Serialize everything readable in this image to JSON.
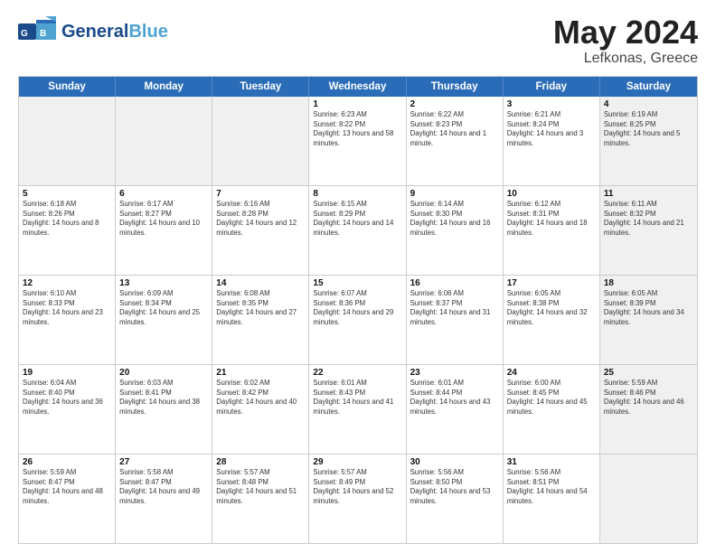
{
  "header": {
    "logo_line1": "General",
    "logo_line2": "Blue",
    "title": "May 2024",
    "location": "Lefkonas, Greece"
  },
  "weekdays": [
    "Sunday",
    "Monday",
    "Tuesday",
    "Wednesday",
    "Thursday",
    "Friday",
    "Saturday"
  ],
  "rows": [
    [
      {
        "day": "",
        "sunrise": "",
        "sunset": "",
        "daylight": "",
        "shaded": true
      },
      {
        "day": "",
        "sunrise": "",
        "sunset": "",
        "daylight": "",
        "shaded": true
      },
      {
        "day": "",
        "sunrise": "",
        "sunset": "",
        "daylight": "",
        "shaded": true
      },
      {
        "day": "1",
        "sunrise": "Sunrise: 6:23 AM",
        "sunset": "Sunset: 8:22 PM",
        "daylight": "Daylight: 13 hours and 58 minutes.",
        "shaded": false
      },
      {
        "day": "2",
        "sunrise": "Sunrise: 6:22 AM",
        "sunset": "Sunset: 8:23 PM",
        "daylight": "Daylight: 14 hours and 1 minute.",
        "shaded": false
      },
      {
        "day": "3",
        "sunrise": "Sunrise: 6:21 AM",
        "sunset": "Sunset: 8:24 PM",
        "daylight": "Daylight: 14 hours and 3 minutes.",
        "shaded": false
      },
      {
        "day": "4",
        "sunrise": "Sunrise: 6:19 AM",
        "sunset": "Sunset: 8:25 PM",
        "daylight": "Daylight: 14 hours and 5 minutes.",
        "shaded": true
      }
    ],
    [
      {
        "day": "5",
        "sunrise": "Sunrise: 6:18 AM",
        "sunset": "Sunset: 8:26 PM",
        "daylight": "Daylight: 14 hours and 8 minutes.",
        "shaded": false
      },
      {
        "day": "6",
        "sunrise": "Sunrise: 6:17 AM",
        "sunset": "Sunset: 8:27 PM",
        "daylight": "Daylight: 14 hours and 10 minutes.",
        "shaded": false
      },
      {
        "day": "7",
        "sunrise": "Sunrise: 6:16 AM",
        "sunset": "Sunset: 8:28 PM",
        "daylight": "Daylight: 14 hours and 12 minutes.",
        "shaded": false
      },
      {
        "day": "8",
        "sunrise": "Sunrise: 6:15 AM",
        "sunset": "Sunset: 8:29 PM",
        "daylight": "Daylight: 14 hours and 14 minutes.",
        "shaded": false
      },
      {
        "day": "9",
        "sunrise": "Sunrise: 6:14 AM",
        "sunset": "Sunset: 8:30 PM",
        "daylight": "Daylight: 14 hours and 16 minutes.",
        "shaded": false
      },
      {
        "day": "10",
        "sunrise": "Sunrise: 6:12 AM",
        "sunset": "Sunset: 8:31 PM",
        "daylight": "Daylight: 14 hours and 18 minutes.",
        "shaded": false
      },
      {
        "day": "11",
        "sunrise": "Sunrise: 6:11 AM",
        "sunset": "Sunset: 8:32 PM",
        "daylight": "Daylight: 14 hours and 21 minutes.",
        "shaded": true
      }
    ],
    [
      {
        "day": "12",
        "sunrise": "Sunrise: 6:10 AM",
        "sunset": "Sunset: 8:33 PM",
        "daylight": "Daylight: 14 hours and 23 minutes.",
        "shaded": false
      },
      {
        "day": "13",
        "sunrise": "Sunrise: 6:09 AM",
        "sunset": "Sunset: 8:34 PM",
        "daylight": "Daylight: 14 hours and 25 minutes.",
        "shaded": false
      },
      {
        "day": "14",
        "sunrise": "Sunrise: 6:08 AM",
        "sunset": "Sunset: 8:35 PM",
        "daylight": "Daylight: 14 hours and 27 minutes.",
        "shaded": false
      },
      {
        "day": "15",
        "sunrise": "Sunrise: 6:07 AM",
        "sunset": "Sunset: 8:36 PM",
        "daylight": "Daylight: 14 hours and 29 minutes.",
        "shaded": false
      },
      {
        "day": "16",
        "sunrise": "Sunrise: 6:06 AM",
        "sunset": "Sunset: 8:37 PM",
        "daylight": "Daylight: 14 hours and 31 minutes.",
        "shaded": false
      },
      {
        "day": "17",
        "sunrise": "Sunrise: 6:05 AM",
        "sunset": "Sunset: 8:38 PM",
        "daylight": "Daylight: 14 hours and 32 minutes.",
        "shaded": false
      },
      {
        "day": "18",
        "sunrise": "Sunrise: 6:05 AM",
        "sunset": "Sunset: 8:39 PM",
        "daylight": "Daylight: 14 hours and 34 minutes.",
        "shaded": true
      }
    ],
    [
      {
        "day": "19",
        "sunrise": "Sunrise: 6:04 AM",
        "sunset": "Sunset: 8:40 PM",
        "daylight": "Daylight: 14 hours and 36 minutes.",
        "shaded": false
      },
      {
        "day": "20",
        "sunrise": "Sunrise: 6:03 AM",
        "sunset": "Sunset: 8:41 PM",
        "daylight": "Daylight: 14 hours and 38 minutes.",
        "shaded": false
      },
      {
        "day": "21",
        "sunrise": "Sunrise: 6:02 AM",
        "sunset": "Sunset: 8:42 PM",
        "daylight": "Daylight: 14 hours and 40 minutes.",
        "shaded": false
      },
      {
        "day": "22",
        "sunrise": "Sunrise: 6:01 AM",
        "sunset": "Sunset: 8:43 PM",
        "daylight": "Daylight: 14 hours and 41 minutes.",
        "shaded": false
      },
      {
        "day": "23",
        "sunrise": "Sunrise: 6:01 AM",
        "sunset": "Sunset: 8:44 PM",
        "daylight": "Daylight: 14 hours and 43 minutes.",
        "shaded": false
      },
      {
        "day": "24",
        "sunrise": "Sunrise: 6:00 AM",
        "sunset": "Sunset: 8:45 PM",
        "daylight": "Daylight: 14 hours and 45 minutes.",
        "shaded": false
      },
      {
        "day": "25",
        "sunrise": "Sunrise: 5:59 AM",
        "sunset": "Sunset: 8:46 PM",
        "daylight": "Daylight: 14 hours and 46 minutes.",
        "shaded": true
      }
    ],
    [
      {
        "day": "26",
        "sunrise": "Sunrise: 5:59 AM",
        "sunset": "Sunset: 8:47 PM",
        "daylight": "Daylight: 14 hours and 48 minutes.",
        "shaded": false
      },
      {
        "day": "27",
        "sunrise": "Sunrise: 5:58 AM",
        "sunset": "Sunset: 8:47 PM",
        "daylight": "Daylight: 14 hours and 49 minutes.",
        "shaded": false
      },
      {
        "day": "28",
        "sunrise": "Sunrise: 5:57 AM",
        "sunset": "Sunset: 8:48 PM",
        "daylight": "Daylight: 14 hours and 51 minutes.",
        "shaded": false
      },
      {
        "day": "29",
        "sunrise": "Sunrise: 5:57 AM",
        "sunset": "Sunset: 8:49 PM",
        "daylight": "Daylight: 14 hours and 52 minutes.",
        "shaded": false
      },
      {
        "day": "30",
        "sunrise": "Sunrise: 5:56 AM",
        "sunset": "Sunset: 8:50 PM",
        "daylight": "Daylight: 14 hours and 53 minutes.",
        "shaded": false
      },
      {
        "day": "31",
        "sunrise": "Sunrise: 5:56 AM",
        "sunset": "Sunset: 8:51 PM",
        "daylight": "Daylight: 14 hours and 54 minutes.",
        "shaded": false
      },
      {
        "day": "",
        "sunrise": "",
        "sunset": "",
        "daylight": "",
        "shaded": true
      }
    ]
  ]
}
